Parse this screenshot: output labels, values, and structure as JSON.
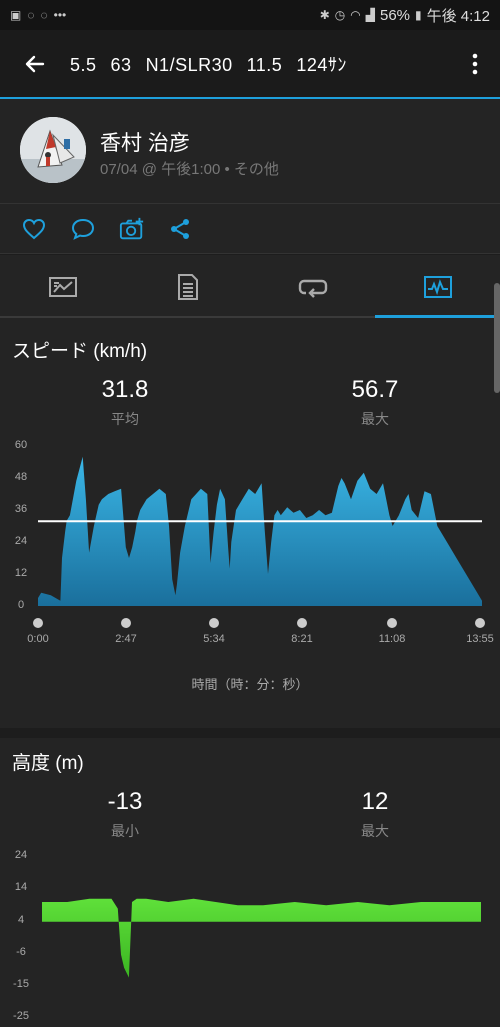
{
  "status_bar": {
    "battery": "56%",
    "time": "午後 4:12",
    "left_icons": [
      "image-icon",
      "sync-icon",
      "sync-icon",
      "more-dots-icon"
    ],
    "right_icons": [
      "bluetooth-icon",
      "alarm-icon",
      "wifi-icon",
      "signal-icon",
      "battery-icon"
    ]
  },
  "toolbar": {
    "segments": [
      "5.5",
      "63",
      "N1/SLR30",
      "11.5",
      "124ｻﾝ"
    ]
  },
  "profile": {
    "name": "香村 治彦",
    "subtitle": "07/04 @ 午後1:00 • その他"
  },
  "actions": [
    "heart-icon",
    "comment-icon",
    "add-photo-icon",
    "share-icon"
  ],
  "tabs": [
    {
      "icon": "summary-icon",
      "active": false
    },
    {
      "icon": "details-icon",
      "active": false
    },
    {
      "icon": "laps-icon",
      "active": false
    },
    {
      "icon": "chart-icon",
      "active": true
    }
  ],
  "speed": {
    "title": "スピード (km/h)",
    "avg_value": "31.8",
    "avg_label": "平均",
    "max_value": "56.7",
    "max_label": "最大",
    "x_caption": "時間（時：分：秒）",
    "y_ticks": [
      "60",
      "48",
      "36",
      "24",
      "12",
      "0"
    ],
    "x_ticks": [
      "0:00",
      "2:47",
      "5:34",
      "8:21",
      "11:08",
      "13:55"
    ]
  },
  "altitude": {
    "title": "高度 (m)",
    "min_value": "-13",
    "min_label": "最小",
    "max_value": "12",
    "max_label": "最大",
    "y_ticks": [
      "24",
      "14",
      "4",
      "-6",
      "-15",
      "-25"
    ]
  },
  "chart_data": [
    {
      "type": "area",
      "title": "スピード (km/h)",
      "xlabel": "時間（時：分：秒）",
      "x_ticks": [
        "0:00",
        "2:47",
        "5:34",
        "8:21",
        "11:08",
        "13:55"
      ],
      "ylim": [
        0,
        60
      ],
      "y_ticks": [
        0,
        12,
        24,
        36,
        48,
        60
      ],
      "reference_line": 31.8,
      "color": "#2aa8dc",
      "x_minutes": [
        0,
        0.1,
        0.4,
        0.7,
        0.75,
        0.85,
        0.9,
        1.0,
        1.2,
        1.4,
        1.5,
        1.6,
        1.75,
        1.9,
        2.0,
        2.2,
        2.4,
        2.6,
        2.75,
        2.85,
        2.95,
        3.05,
        3.1,
        3.2,
        3.4,
        3.6,
        3.8,
        4.0,
        4.1,
        4.2,
        4.3,
        4.35,
        4.45,
        4.6,
        4.8,
        4.95,
        5.1,
        5.3,
        5.4,
        5.5,
        5.6,
        5.7,
        5.85,
        5.95,
        6.0,
        6.05,
        6.2,
        6.4,
        6.6,
        6.8,
        7.0,
        7.1,
        7.2,
        7.3,
        7.4,
        7.5,
        7.6,
        7.8,
        8.0,
        8.2,
        8.4,
        8.6,
        8.8,
        9.0,
        9.2,
        9.4,
        9.5,
        9.6,
        9.8,
        10.0,
        10.2,
        10.4,
        10.6,
        10.8,
        10.9,
        11.0,
        11.1,
        11.3,
        11.5,
        11.6,
        11.7,
        11.9,
        12.1,
        12.3,
        12.5,
        12.8,
        13.1,
        13.4,
        13.7,
        13.9
      ],
      "values": [
        3,
        5,
        4,
        2,
        18,
        28,
        32,
        34,
        47,
        56,
        40,
        20,
        30,
        38,
        40,
        42,
        43,
        44,
        22,
        18,
        22,
        28,
        32,
        36,
        40,
        42,
        44,
        42,
        30,
        10,
        4,
        8,
        20,
        30,
        40,
        42,
        44,
        42,
        16,
        28,
        38,
        44,
        40,
        22,
        14,
        24,
        36,
        40,
        44,
        42,
        46,
        28,
        12,
        24,
        34,
        36,
        34,
        37,
        35,
        36,
        33,
        34,
        36,
        34,
        35,
        45,
        48,
        46,
        40,
        47,
        50,
        44,
        42,
        46,
        40,
        34,
        30,
        34,
        40,
        42,
        36,
        33,
        43,
        42,
        30,
        24,
        18,
        12,
        6,
        2
      ]
    },
    {
      "type": "area",
      "title": "高度 (m)",
      "ylim": [
        -25,
        24
      ],
      "y_ticks": [
        -25,
        -15,
        -6,
        4,
        14,
        24
      ],
      "color": "#4fd131",
      "x_minutes": [
        0,
        0.8,
        1.5,
        2.2,
        2.4,
        2.5,
        2.6,
        2.75,
        2.85,
        3.0,
        3.3,
        4.0,
        4.8,
        5.5,
        6.2,
        7.0,
        8.0,
        9.0,
        10.0,
        11.0,
        12.0,
        13.0,
        13.9
      ],
      "values": [
        10,
        10,
        11,
        11,
        8,
        -6,
        -10,
        -13,
        10,
        11,
        11,
        10,
        11,
        10,
        9,
        9,
        10,
        9,
        10,
        9,
        10,
        10,
        10
      ]
    }
  ]
}
